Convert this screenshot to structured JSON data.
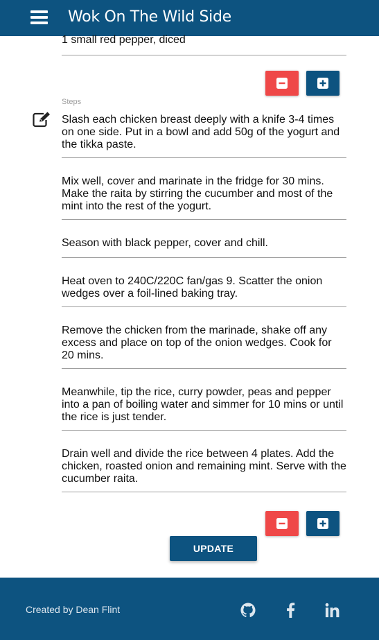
{
  "navbar": {
    "title": "Wok On The Wild Side",
    "menu_icon": "hamburger-menu-icon"
  },
  "ingredients": {
    "last_item": "1 small red pepper, diced"
  },
  "steps": {
    "label": "Steps",
    "edit_icon": "edit-icon",
    "items": [
      "Slash each chicken breast deeply with a knife 3-4 times on one side. Put in a bowl and add 50g of the yogurt and the tikka paste.",
      "Mix well, cover and marinate in the fridge for 30 mins. Make the raita by stirring the cucumber and most of the mint into the rest of the yogurt.",
      "Season with black pepper, cover and chill.",
      "Heat oven to 240C/220C fan/gas 9. Scatter the onion wedges over a foil-lined baking tray.",
      "Remove the chicken from the marinade, shake off any excess and place on top of the onion wedges. Cook for 20 mins.",
      "Meanwhile, tip the rice, curry powder, peas and pepper into a pan of boiling water and simmer for 10 mins or until the rice is just tender.",
      "Drain well and divide the rice between 4 plates. Add the chicken, roasted onion and remaining mint. Serve with the cucumber raita."
    ]
  },
  "buttons": {
    "update_label": "UPDATE",
    "remove_icon": "minus-box-icon",
    "add_icon": "plus-box-icon"
  },
  "footer": {
    "credit": "Created by Dean Flint",
    "icons": [
      "github-icon",
      "facebook-icon",
      "linkedin-icon"
    ]
  },
  "colors": {
    "primary": "#0d5380",
    "danger": "#ef4848",
    "divider": "#9e9e9e"
  }
}
